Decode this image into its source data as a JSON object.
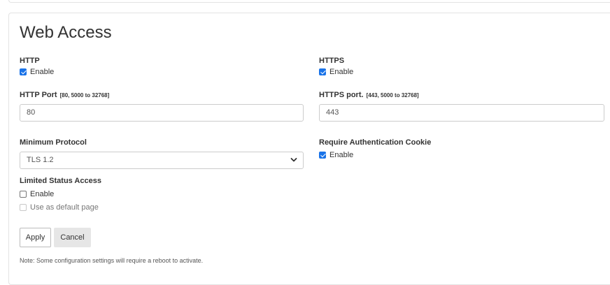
{
  "page": {
    "title": "Web Access"
  },
  "http": {
    "label": "HTTP",
    "enable_label": "Enable",
    "enabled": true,
    "port_label": "HTTP Port",
    "port_hint": "[80, 5000 to 32768]",
    "port_value": "80"
  },
  "https": {
    "label": "HTTPS",
    "enable_label": "Enable",
    "enabled": true,
    "port_label": "HTTPS port.",
    "port_hint": "[443, 5000 to 32768]",
    "port_value": "443"
  },
  "minimum_protocol": {
    "label": "Minimum Protocol",
    "selected": "TLS 1.2"
  },
  "auth_cookie": {
    "label": "Require Authentication Cookie",
    "enable_label": "Enable",
    "enabled": true
  },
  "limited_status": {
    "label": "Limited Status Access",
    "enable_label": "Enable",
    "enabled": false,
    "default_page_label": "Use as default page",
    "default_page_checked": false,
    "default_page_disabled": true
  },
  "actions": {
    "apply_label": "Apply",
    "cancel_label": "Cancel"
  },
  "note": "Note: Some configuration settings will require a reboot to activate.",
  "colors": {
    "checkbox_accent": "#1a73e8",
    "border": "#cccccc",
    "cancel_bg": "#e6e6e6"
  }
}
